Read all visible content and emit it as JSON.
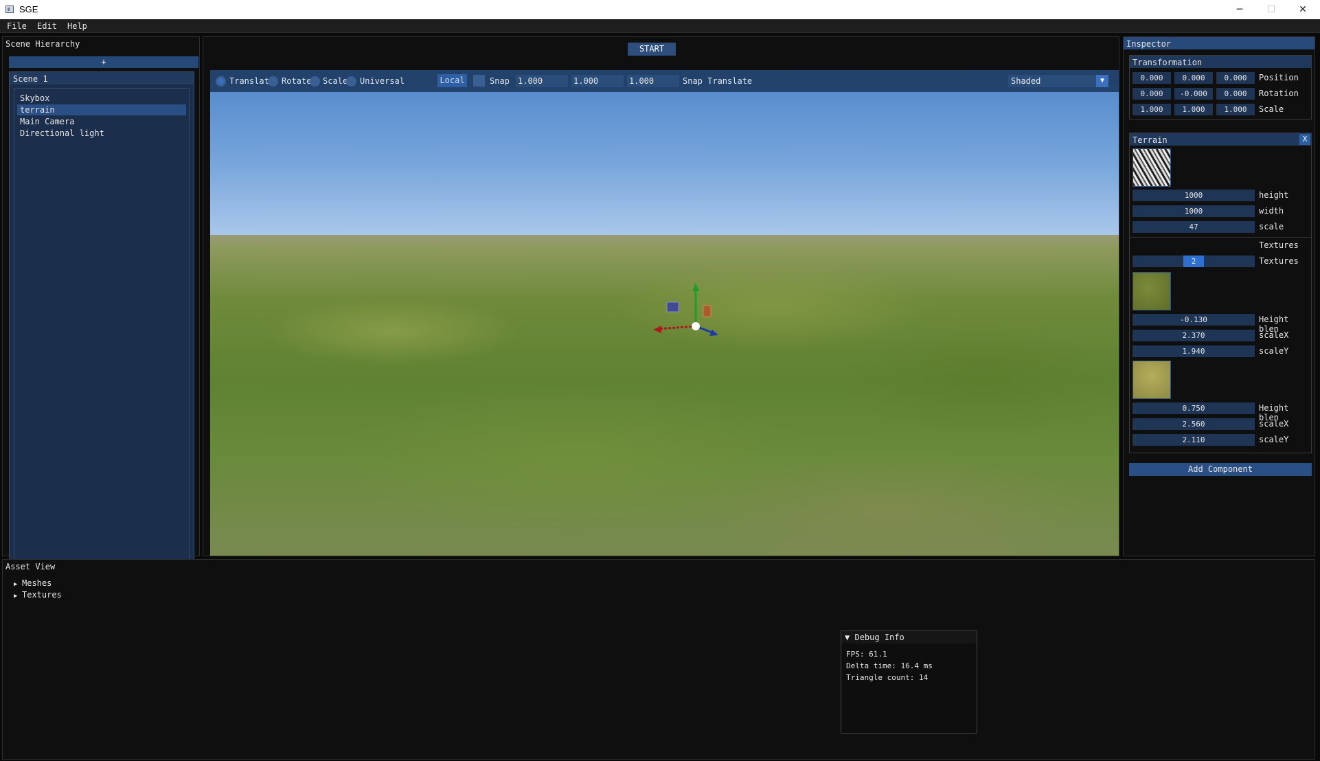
{
  "window": {
    "title": "SGE",
    "minimize": "─",
    "maximize": "☐",
    "close": "✕"
  },
  "menu": [
    "File",
    "Edit",
    "Help"
  ],
  "hierarchy": {
    "title": "Scene Hierarchy",
    "add_label": "+",
    "scene_name": "Scene 1",
    "items": [
      "Skybox",
      "terrain",
      "Main Camera",
      "Directional light"
    ],
    "selected": "terrain"
  },
  "viewport": {
    "start_label": "START",
    "modes": [
      "Translate",
      "Rotate",
      "Scale",
      "Universal"
    ],
    "active_mode": "Translate",
    "local_label": "Local",
    "snap_label": "Snap",
    "snap_values": [
      "1.000",
      "1.000",
      "1.000"
    ],
    "snap_mode_label": "Snap Translate",
    "shading": "Shaded"
  },
  "inspector": {
    "title": "Inspector",
    "transform": {
      "title": "Transformation",
      "rows": [
        {
          "label": "Position",
          "values": [
            "0.000",
            "0.000",
            "0.000"
          ]
        },
        {
          "label": "Rotation",
          "values": [
            "0.000",
            "-0.000",
            "0.000"
          ]
        },
        {
          "label": "Scale",
          "values": [
            "1.000",
            "1.000",
            "1.000"
          ]
        }
      ]
    },
    "terrain": {
      "title": "Terrain",
      "close_label": "X",
      "height": "1000",
      "height_label": "height",
      "width": "1000",
      "width_label": "width",
      "scale": "47",
      "scale_label": "scale",
      "textures_header": "Textures",
      "texture_count": "2",
      "texture_count_label": "Textures",
      "layers": [
        {
          "blend": "-0.130",
          "blend_label": "Height blen",
          "scalex": "2.370",
          "scalex_label": "scaleX",
          "scaley": "1.940",
          "scaley_label": "scaleY"
        },
        {
          "blend": "0.750",
          "blend_label": "Height blen",
          "scalex": "2.560",
          "scalex_label": "scaleX",
          "scaley": "2.110",
          "scaley_label": "scaleY"
        }
      ]
    },
    "add_component": "Add Component"
  },
  "asset_view": {
    "title": "Asset View",
    "folders": [
      "Meshes",
      "Textures"
    ],
    "folder_arrow": "▶"
  },
  "debug": {
    "title": "Debug Info",
    "arrow": "▼",
    "fps": "FPS: 61.1",
    "delta": "Delta time: 16.4 ms",
    "triangles": "Triangle count: 14"
  },
  "colors": {
    "accent": "#264a78",
    "panel_bg": "#0f0f0f",
    "header": "#274a7a"
  }
}
